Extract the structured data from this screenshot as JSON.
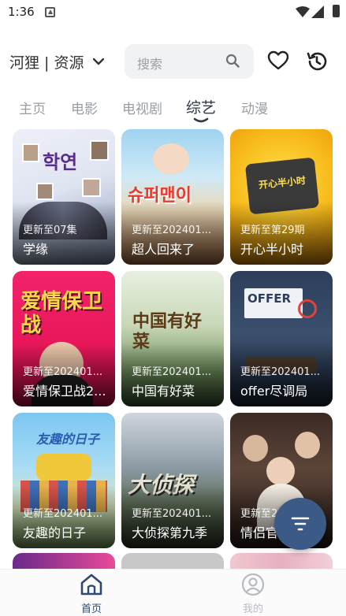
{
  "status_bar": {
    "time": "1:36"
  },
  "header": {
    "source_label": "河狸 | 资源",
    "search_placeholder": "搜索"
  },
  "tabs": [
    {
      "label": "主页",
      "active": false
    },
    {
      "label": "电影",
      "active": false
    },
    {
      "label": "电视剧",
      "active": false
    },
    {
      "label": "综艺",
      "active": true
    },
    {
      "label": "动漫",
      "active": false
    }
  ],
  "cards": [
    {
      "title": "学缘",
      "update": "更新至07集",
      "poster_text": "학연"
    },
    {
      "title": "超人回来了",
      "update": "更新至202401...",
      "poster_text": "슈퍼맨이"
    },
    {
      "title": "开心半小时",
      "update": "更新至第29期",
      "poster_text": "开心半小时"
    },
    {
      "title": "爱情保卫战2...",
      "update": "更新至202401...",
      "poster_text": "爱情保卫战"
    },
    {
      "title": "中国有好菜",
      "update": "更新至202401...",
      "poster_text": "中国有好菜"
    },
    {
      "title": "offer尽调局",
      "update": "更新至202401...",
      "poster_text": "OFFER"
    },
    {
      "title": "友趣的日子",
      "update": "更新至202401...",
      "poster_text": "友趣的日子"
    },
    {
      "title": "大侦探第九季",
      "update": "更新至202401...",
      "poster_text": "大侦探"
    },
    {
      "title": "情侣官...",
      "update": "更新至202401...",
      "poster_text": ""
    }
  ],
  "bottom_nav": [
    {
      "label": "首页",
      "active": true
    },
    {
      "label": "我的",
      "active": false
    }
  ],
  "colors": {
    "accent": "#3b5a86",
    "tab_active": "#2d3748",
    "tab_inactive": "#9a9ea3"
  }
}
